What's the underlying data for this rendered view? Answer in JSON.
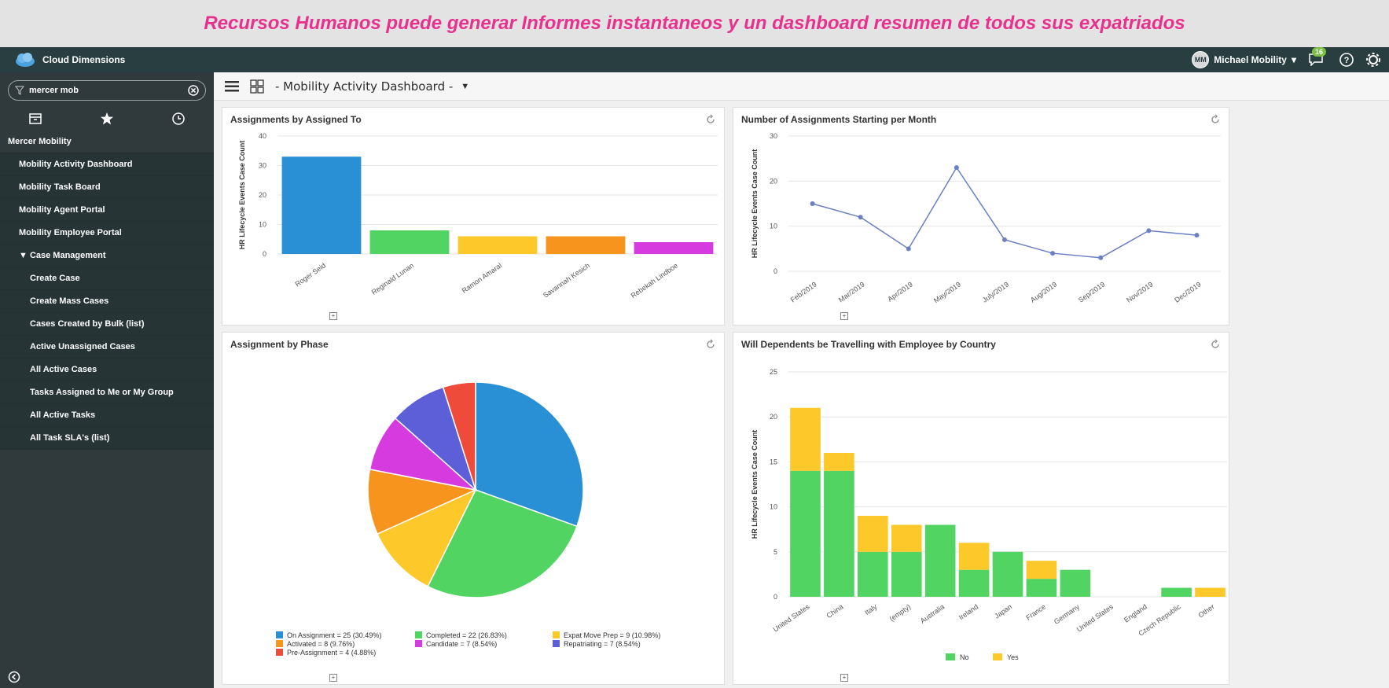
{
  "banner": {
    "text": "Recursos Humanos puede generar Informes instantaneos y un dashboard resumen de todos sus expatriados"
  },
  "topbar": {
    "app_name": "Cloud Dimensions",
    "user_initials": "MM",
    "user_name": "Michael Mobility",
    "notifications_count": "16",
    "icons": [
      "cloud-logo",
      "chat-icon",
      "help-icon",
      "gear-icon"
    ]
  },
  "sidebar": {
    "filter_value": "mercer mob",
    "nav_tabs": [
      "archive-icon",
      "star-icon",
      "clock-icon"
    ],
    "items": [
      {
        "label": "Mercer Mobility",
        "kind": "header"
      },
      {
        "label": "Mobility Activity Dashboard",
        "kind": "item"
      },
      {
        "label": "Mobility Task Board",
        "kind": "item"
      },
      {
        "label": "Mobility Agent Portal",
        "kind": "item"
      },
      {
        "label": "Mobility Employee Portal",
        "kind": "item"
      },
      {
        "label": "▼ Case Management",
        "kind": "group"
      },
      {
        "label": "Create Case",
        "kind": "sub"
      },
      {
        "label": "Create Mass Cases",
        "kind": "sub"
      },
      {
        "label": "Cases Created by Bulk (list)",
        "kind": "sub"
      },
      {
        "label": "Active Unassigned Cases",
        "kind": "sub"
      },
      {
        "label": "All Active Cases",
        "kind": "sub"
      },
      {
        "label": "Tasks Assigned to Me or My Group",
        "kind": "sub"
      },
      {
        "label": "All Active Tasks",
        "kind": "sub"
      },
      {
        "label": "All Task SLA's (list)",
        "kind": "sub"
      }
    ]
  },
  "toolbar": {
    "dashboard_title": "- Mobility Activity Dashboard -",
    "caret": "▼"
  },
  "colors": {
    "blue": "#2a90d6",
    "green": "#52d462",
    "yellow": "#fcc82a",
    "orange": "#f7941d",
    "magenta": "#d63be0",
    "red": "#ee4b3a",
    "purple": "#5d5fd9",
    "line": "#6b7fc4"
  },
  "chart_data": [
    {
      "id": "assigned",
      "type": "bar",
      "title": "Assignments by Assigned To",
      "ylabel": "HR Lifecycle Events Case Count",
      "ylim": [
        0,
        40
      ],
      "yticks": [
        0,
        10,
        20,
        30,
        40
      ],
      "categories": [
        "Roger Seid",
        "Reginald Lunan",
        "Ramon Amaral",
        "Savannah Kesich",
        "Rebekah Lindboe"
      ],
      "values": [
        33,
        8,
        6,
        6,
        4
      ],
      "colors": [
        "#2a90d6",
        "#52d462",
        "#fcc82a",
        "#f7941d",
        "#d63be0"
      ]
    },
    {
      "id": "monthly",
      "type": "line",
      "title": "Number of Assignments Starting per Month",
      "ylabel": "HR Lifecycle Events Case Count",
      "ylim": [
        0,
        30
      ],
      "yticks": [
        0,
        10,
        20,
        30
      ],
      "categories": [
        "Feb/2019",
        "Mar/2019",
        "Apr/2019",
        "May/2019",
        "July/2019",
        "Aug/2019",
        "Sep/2019",
        "Nov/2019",
        "Dec/2019"
      ],
      "values": [
        15,
        12,
        5,
        23,
        7,
        4,
        3,
        9,
        8
      ]
    },
    {
      "id": "phase",
      "type": "pie",
      "title": "Assignment by Phase",
      "slices": [
        {
          "name": "On Assignment = 25 (30.49%)",
          "value": 25,
          "color": "#2a90d6"
        },
        {
          "name": "Completed = 22 (26.83%)",
          "value": 22,
          "color": "#52d462"
        },
        {
          "name": "Expat Move Prep = 9 (10.98%)",
          "value": 9,
          "color": "#fcc82a"
        },
        {
          "name": "Activated = 8 (9.76%)",
          "value": 8,
          "color": "#f7941d"
        },
        {
          "name": "Candidate = 7 (8.54%)",
          "value": 7,
          "color": "#d63be0"
        },
        {
          "name": "Repatriating = 7 (8.54%)",
          "value": 7,
          "color": "#5d5fd9"
        },
        {
          "name": "Pre-Assignment = 4 (4.88%)",
          "value": 4,
          "color": "#ee4b3a"
        }
      ]
    },
    {
      "id": "dependents",
      "type": "bar",
      "title": "Will Dependents be Travelling with Employee by Country",
      "ylabel": "HR Lifecycle Events Case Count",
      "ylim": [
        0,
        25
      ],
      "yticks": [
        0,
        5,
        10,
        15,
        20,
        25
      ],
      "stacked": true,
      "categories": [
        "United States",
        "China",
        "Italy",
        "(empty)",
        "Australia",
        "Ireland",
        "Japan",
        "France",
        "Germany",
        "United States",
        "England",
        "Czech Republic",
        "Other"
      ],
      "series": [
        {
          "name": "No",
          "color": "#52d462",
          "values": [
            14,
            14,
            5,
            5,
            8,
            3,
            5,
            2,
            3,
            0,
            0,
            1,
            0
          ]
        },
        {
          "name": "Yes",
          "color": "#fcc82a",
          "values": [
            7,
            2,
            4,
            3,
            0,
            3,
            0,
            2,
            0,
            0,
            0,
            0,
            1
          ]
        }
      ]
    }
  ]
}
